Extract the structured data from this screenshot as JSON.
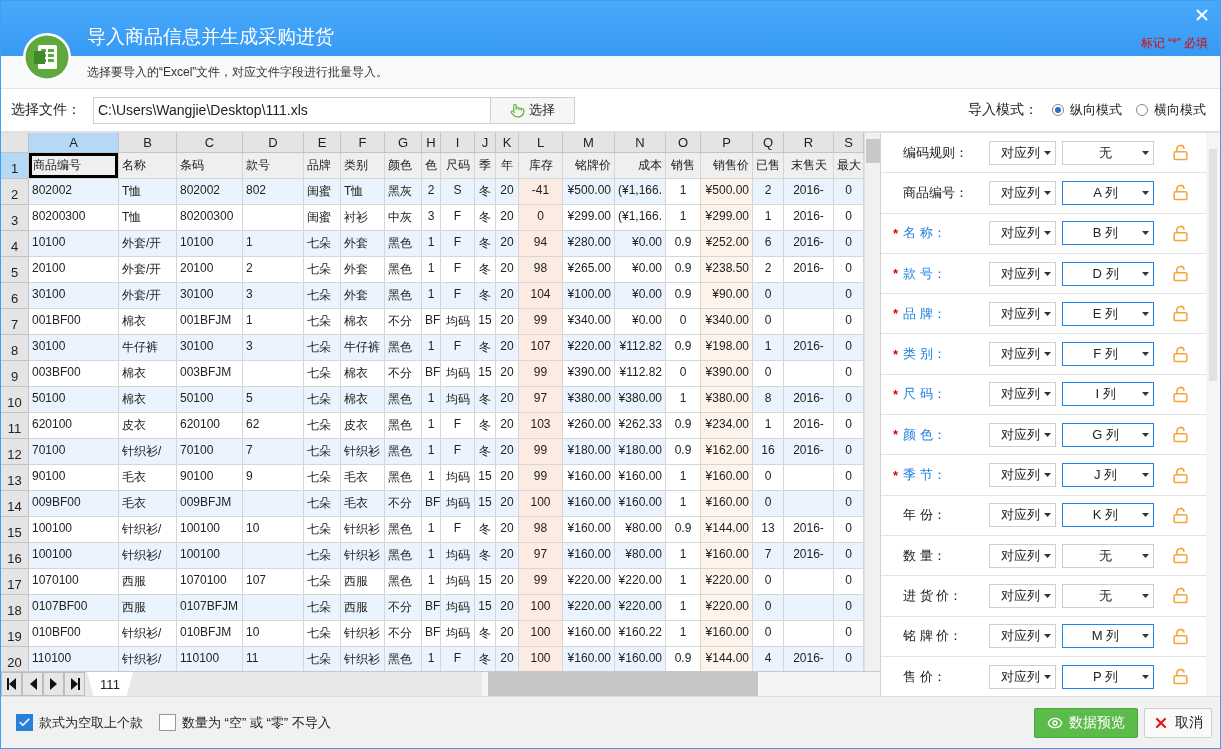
{
  "window": {
    "title": "导入商品信息并生成采购进货",
    "subtitle": "选择要导入的“Excel”文件，对应文件字段进行批量导入。",
    "required_note": "标记 “*” 必填"
  },
  "file": {
    "label": "选择文件：",
    "value": "C:\\Users\\Wangjie\\Desktop\\111.xls",
    "button": "选择"
  },
  "import_mode": {
    "label": "导入模式：",
    "options": [
      {
        "label": "纵向模式",
        "selected": true
      },
      {
        "label": "横向模式",
        "selected": false
      }
    ]
  },
  "sheet": {
    "columns": [
      {
        "label": "A",
        "selected": true
      },
      {
        "label": "B",
        "selected": false
      },
      {
        "label": "C",
        "selected": false
      },
      {
        "label": "D",
        "selected": false
      },
      {
        "label": "E",
        "selected": false
      },
      {
        "label": "F",
        "selected": false
      },
      {
        "label": "G",
        "selected": false
      },
      {
        "label": "H",
        "selected": false
      },
      {
        "label": "I",
        "selected": false
      },
      {
        "label": "J",
        "selected": false
      },
      {
        "label": "K",
        "selected": false
      },
      {
        "label": "L",
        "selected": false
      },
      {
        "label": "M",
        "selected": false
      },
      {
        "label": "N",
        "selected": false
      },
      {
        "label": "O",
        "selected": false
      },
      {
        "label": "P",
        "selected": false
      },
      {
        "label": "Q",
        "selected": false
      },
      {
        "label": "R",
        "selected": false
      },
      {
        "label": "S",
        "selected": false
      }
    ],
    "rows": [
      {
        "number": "1",
        "selected": true,
        "cells": [
          "商品编号",
          "名称",
          "条码",
          "款号",
          "品牌",
          "类别",
          "颜色",
          "色",
          "尺码",
          "季",
          "年",
          "库存",
          "铭牌价",
          "成本",
          "销售",
          "销售价",
          "已售",
          "末售天",
          "最大"
        ]
      },
      {
        "number": "2",
        "selected": false,
        "cells": [
          "802002",
          "T恤",
          "802002",
          "802",
          "闺蜜",
          "T恤",
          "黑灰",
          "2",
          "S",
          "冬",
          "20",
          "-41",
          "¥500.00",
          "(¥1,166.",
          "1",
          "¥500.00",
          "2",
          "2016-",
          "0"
        ]
      },
      {
        "number": "3",
        "selected": false,
        "cells": [
          "80200300",
          "T恤",
          "80200300",
          null,
          "闺蜜",
          "衬衫",
          "中灰",
          "3",
          "F",
          "冬",
          "20",
          "0",
          "¥299.00",
          "(¥1,166.",
          "1",
          "¥299.00",
          "1",
          "2016-",
          "0"
        ]
      },
      {
        "number": "4",
        "selected": false,
        "cells": [
          "10100",
          "外套/开",
          "10100",
          "1",
          "七朵",
          "外套",
          "黑色",
          "1",
          "F",
          "冬",
          "20",
          "94",
          "¥280.00",
          "¥0.00",
          "0.9",
          "¥252.00",
          "6",
          "2016-",
          "0"
        ]
      },
      {
        "number": "5",
        "selected": false,
        "cells": [
          "20100",
          "外套/开",
          "20100",
          "2",
          "七朵",
          "外套",
          "黑色",
          "1",
          "F",
          "冬",
          "20",
          "98",
          "¥265.00",
          "¥0.00",
          "0.9",
          "¥238.50",
          "2",
          "2016-",
          "0"
        ]
      },
      {
        "number": "6",
        "selected": false,
        "cells": [
          "30100",
          "外套/开",
          "30100",
          "3",
          "七朵",
          "外套",
          "黑色",
          "1",
          "F",
          "冬",
          "20",
          "104",
          "¥100.00",
          "¥0.00",
          "0.9",
          "¥90.00",
          "0",
          null,
          "0"
        ]
      },
      {
        "number": "7",
        "selected": false,
        "cells": [
          "001BF00",
          "棉衣",
          "001BFJM",
          "1",
          "七朵",
          "棉衣",
          "不分",
          "BF",
          "均码",
          "15",
          "20",
          "99",
          "¥340.00",
          "¥0.00",
          "0",
          "¥340.00",
          "0",
          null,
          "0"
        ]
      },
      {
        "number": "8",
        "selected": false,
        "cells": [
          "30100",
          "牛仔裤",
          "30100",
          "3",
          "七朵",
          "牛仔裤",
          "黑色",
          "1",
          "F",
          "冬",
          "20",
          "107",
          "¥220.00",
          "¥112.82",
          "0.9",
          "¥198.00",
          "1",
          "2016-",
          "0"
        ]
      },
      {
        "number": "9",
        "selected": false,
        "cells": [
          "003BF00",
          "棉衣",
          "003BFJM",
          null,
          "七朵",
          "棉衣",
          "不分",
          "BF",
          "均码",
          "15",
          "20",
          "99",
          "¥390.00",
          "¥112.82",
          "0",
          "¥390.00",
          "0",
          null,
          "0"
        ]
      },
      {
        "number": "10",
        "selected": false,
        "cells": [
          "50100",
          "棉衣",
          "50100",
          "5",
          "七朵",
          "棉衣",
          "黑色",
          "1",
          "均码",
          "冬",
          "20",
          "97",
          "¥380.00",
          "¥380.00",
          "1",
          "¥380.00",
          "8",
          "2016-",
          "0"
        ]
      },
      {
        "number": "11",
        "selected": false,
        "cells": [
          "620100",
          "皮衣",
          "620100",
          "62",
          "七朵",
          "皮衣",
          "黑色",
          "1",
          "F",
          "冬",
          "20",
          "103",
          "¥260.00",
          "¥262.33",
          "0.9",
          "¥234.00",
          "1",
          "2016-",
          "0"
        ]
      },
      {
        "number": "12",
        "selected": false,
        "cells": [
          "70100",
          "针织衫/",
          "70100",
          "7",
          "七朵",
          "针织衫",
          "黑色",
          "1",
          "F",
          "冬",
          "20",
          "99",
          "¥180.00",
          "¥180.00",
          "0.9",
          "¥162.00",
          "16",
          "2016-",
          "0"
        ]
      },
      {
        "number": "13",
        "selected": false,
        "cells": [
          "90100",
          "毛衣",
          "90100",
          "9",
          "七朵",
          "毛衣",
          "黑色",
          "1",
          "均码",
          "15",
          "20",
          "99",
          "¥160.00",
          "¥160.00",
          "1",
          "¥160.00",
          "0",
          null,
          "0"
        ]
      },
      {
        "number": "14",
        "selected": false,
        "cells": [
          "009BF00",
          "毛衣",
          "009BFJM",
          null,
          "七朵",
          "毛衣",
          "不分",
          "BF",
          "均码",
          "15",
          "20",
          "100",
          "¥160.00",
          "¥160.00",
          "1",
          "¥160.00",
          "0",
          null,
          "0"
        ]
      },
      {
        "number": "15",
        "selected": false,
        "cells": [
          "100100",
          "针织衫/",
          "100100",
          "10",
          "七朵",
          "针织衫",
          "黑色",
          "1",
          "F",
          "冬",
          "20",
          "98",
          "¥160.00",
          "¥80.00",
          "0.9",
          "¥144.00",
          "13",
          "2016-",
          "0"
        ]
      },
      {
        "number": "16",
        "selected": false,
        "cells": [
          "100100",
          "针织衫/",
          "100100",
          null,
          "七朵",
          "针织衫",
          "黑色",
          "1",
          "均码",
          "冬",
          "20",
          "97",
          "¥160.00",
          "¥80.00",
          "1",
          "¥160.00",
          "7",
          "2016-",
          "0"
        ]
      },
      {
        "number": "17",
        "selected": false,
        "cells": [
          "1070100",
          "西服",
          "1070100",
          "107",
          "七朵",
          "西服",
          "黑色",
          "1",
          "均码",
          "15",
          "20",
          "99",
          "¥220.00",
          "¥220.00",
          "1",
          "¥220.00",
          "0",
          null,
          "0"
        ]
      },
      {
        "number": "18",
        "selected": false,
        "cells": [
          "0107BF00",
          "西服",
          "0107BFJM",
          null,
          "七朵",
          "西服",
          "不分",
          "BF",
          "均码",
          "15",
          "20",
          "100",
          "¥220.00",
          "¥220.00",
          "1",
          "¥220.00",
          "0",
          null,
          "0"
        ]
      },
      {
        "number": "19",
        "selected": false,
        "cells": [
          "010BF00",
          "针织衫/",
          "010BFJM",
          "10",
          "七朵",
          "针织衫",
          "不分",
          "BF",
          "均码",
          "冬",
          "20",
          "100",
          "¥160.00",
          "¥160.22",
          "1",
          "¥160.00",
          "0",
          null,
          "0"
        ]
      },
      {
        "number": "20",
        "selected": false,
        "cells": [
          "110100",
          "针织衫/",
          "110100",
          "11",
          "七朵",
          "针织衫",
          "黑色",
          "1",
          "F",
          "冬",
          "20",
          "100",
          "¥160.00",
          "¥160.00",
          "0.9",
          "¥144.00",
          "4",
          "2016-",
          "0"
        ]
      }
    ],
    "tabs": [
      {
        "label": "111",
        "selected": true
      }
    ]
  },
  "mapping": {
    "required_mark": "*",
    "items": [
      {
        "label": "编码规则：",
        "required": false,
        "mode": "对应列",
        "column": "无",
        "mapped": false
      },
      {
        "label": "商品编号：",
        "required": false,
        "mode": "对应列",
        "column": "A 列",
        "mapped": true
      },
      {
        "label": "名 称：",
        "required": true,
        "mode": "对应列",
        "column": "B 列",
        "mapped": true
      },
      {
        "label": "款 号：",
        "required": true,
        "mode": "对应列",
        "column": "D 列",
        "mapped": true
      },
      {
        "label": "品 牌：",
        "required": true,
        "mode": "对应列",
        "column": "E 列",
        "mapped": true
      },
      {
        "label": "类 别：",
        "required": true,
        "mode": "对应列",
        "column": "F 列",
        "mapped": true
      },
      {
        "label": "尺 码：",
        "required": true,
        "mode": "对应列",
        "column": "I 列",
        "mapped": true
      },
      {
        "label": "颜 色：",
        "required": true,
        "mode": "对应列",
        "column": "G 列",
        "mapped": true
      },
      {
        "label": "季 节：",
        "required": true,
        "mode": "对应列",
        "column": "J 列",
        "mapped": true
      },
      {
        "label": "年 份：",
        "required": false,
        "mode": "对应列",
        "column": "K 列",
        "mapped": true
      },
      {
        "label": "数 量：",
        "required": false,
        "mode": "对应列",
        "column": "无",
        "mapped": false
      },
      {
        "label": "进 货 价：",
        "required": false,
        "mode": "对应列",
        "column": "无",
        "mapped": false
      },
      {
        "label": "铭 牌 价：",
        "required": false,
        "mode": "对应列",
        "column": "M 列",
        "mapped": true
      },
      {
        "label": "售 价：",
        "required": false,
        "mode": "对应列",
        "column": "P 列",
        "mapped": true
      }
    ]
  },
  "options": [
    {
      "label": "款式为空取上个款",
      "checked": true
    },
    {
      "label": "数量为 “空” 或 “零” 不导入",
      "checked": false
    }
  ],
  "buttons": [
    {
      "label": "数据预览",
      "kind": "primary"
    },
    {
      "label": "取消",
      "kind": "cancel"
    }
  ]
}
